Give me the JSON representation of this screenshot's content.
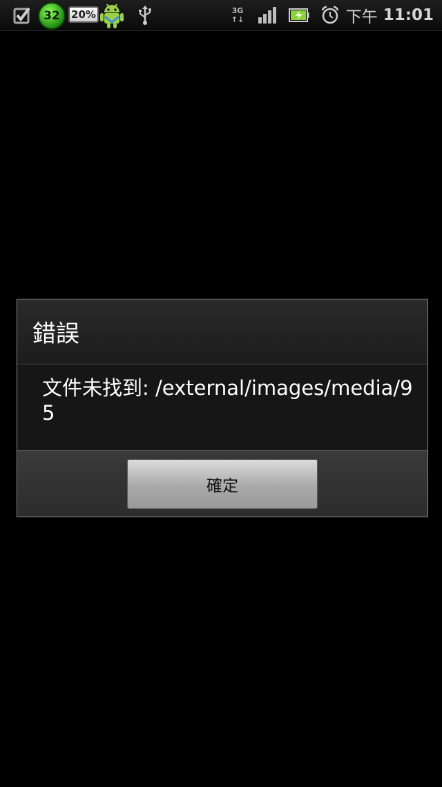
{
  "status_bar": {
    "icons": {
      "check": "checkbox-icon",
      "badge": "temperature-badge-icon",
      "battery_widget": "battery-percent-icon",
      "android": "android-icon",
      "usb": "usb-icon",
      "network": "3g-data-icon",
      "signal": "signal-strength-icon",
      "battery": "battery-icon",
      "alarm": "alarm-clock-icon"
    },
    "badge_value": "32",
    "battery_widget_text": "20%",
    "network_type": "3G",
    "network_arrows": "↑↓",
    "clock_ampm": "下午",
    "clock_time": "11:01"
  },
  "dialog": {
    "title": "錯誤",
    "message": "文件未找到: /external/images/media/95",
    "ok_label": "確定"
  },
  "colors": {
    "background": "#000000",
    "dialog_bg": "#161616",
    "badge_green": "#1d8a12"
  }
}
